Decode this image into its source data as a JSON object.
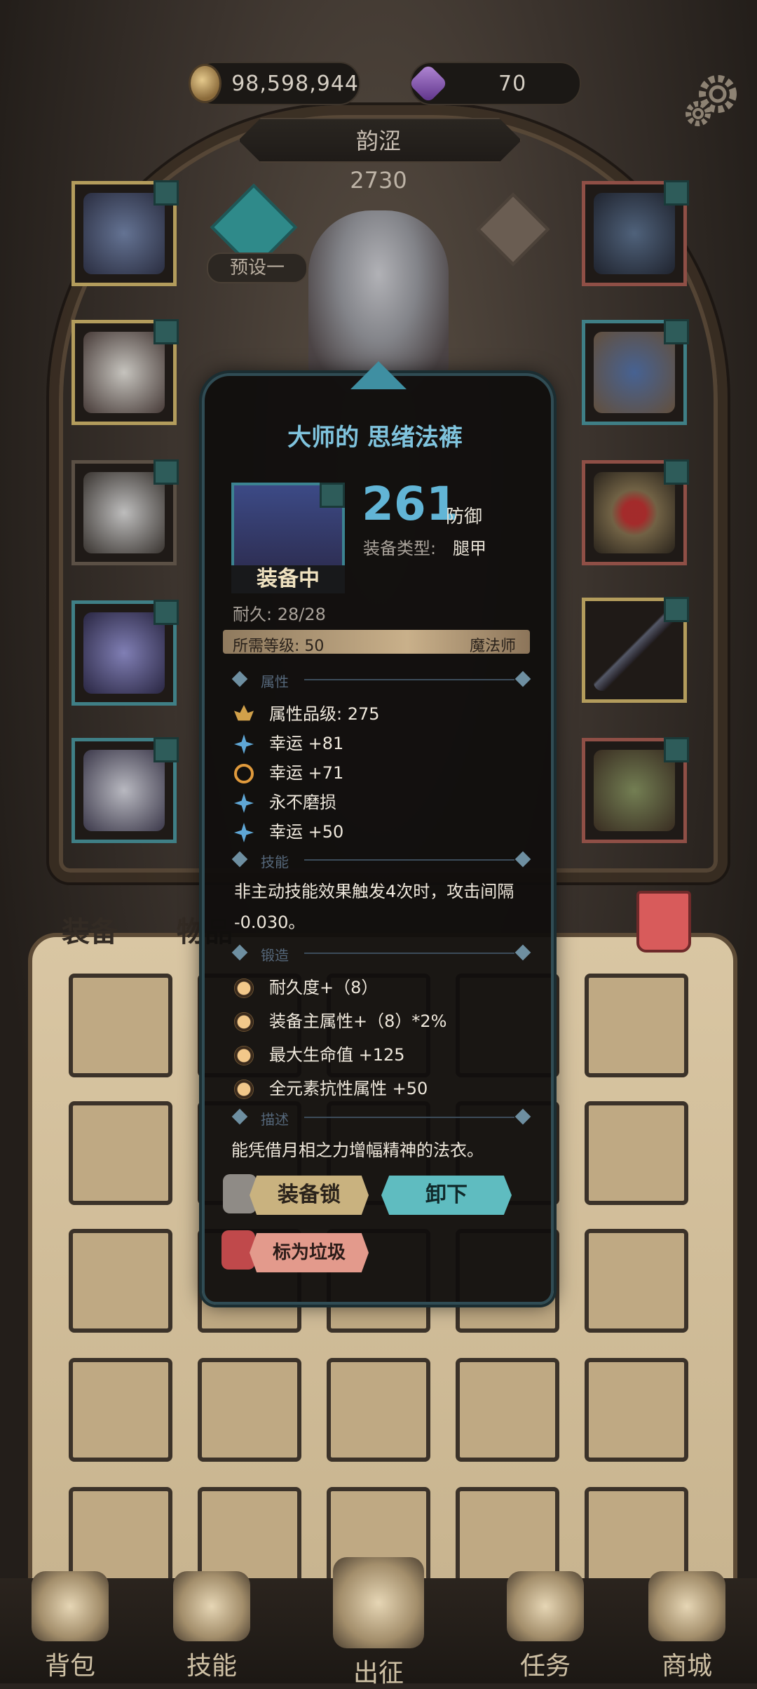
{
  "resources": {
    "gold": "98,598,944",
    "gems": "70"
  },
  "hero": {
    "name": "韵涩",
    "power": "2730",
    "preset": "预设一"
  },
  "tabs": {
    "equipment": "装备",
    "items": "物品"
  },
  "nav": [
    {
      "label": "背包",
      "icon": "backpack-icon"
    },
    {
      "label": "技能",
      "icon": "skill-book-icon"
    },
    {
      "label": "出征",
      "icon": "sword-icon"
    },
    {
      "label": "任务",
      "icon": "quest-horn-icon"
    },
    {
      "label": "商城",
      "icon": "shop-icon"
    }
  ],
  "item": {
    "title": "大师的 思绪法裤",
    "equipped": "装备中",
    "defense": "261",
    "defense_label": "防御",
    "type_label": "装备类型:",
    "type_value": "腿甲",
    "durability": "耐久: 28/28",
    "req_level": "所需等级: 50",
    "req_class": "魔法师",
    "sections": {
      "attributes": "属性",
      "skills": "技能",
      "forge": "锻造",
      "description": "描述"
    },
    "attributes": [
      "属性品级: 275",
      "幸运 +81",
      "幸运 +71",
      "永不磨损",
      "幸运 +50"
    ],
    "skill_line1": "非主动技能效果触发4次时，攻击间隔",
    "skill_line2": "-0.030。",
    "forge": [
      "耐久度+（8）",
      "装备主属性+（8）*2%",
      "最大生命值 +125",
      "全元素抗性属性 +50"
    ],
    "description": "能凭借月相之力增幅精神的法衣。",
    "buttons": {
      "lock": "装备锁",
      "unequip": "卸下",
      "mark_trash": "标为垃圾"
    }
  }
}
